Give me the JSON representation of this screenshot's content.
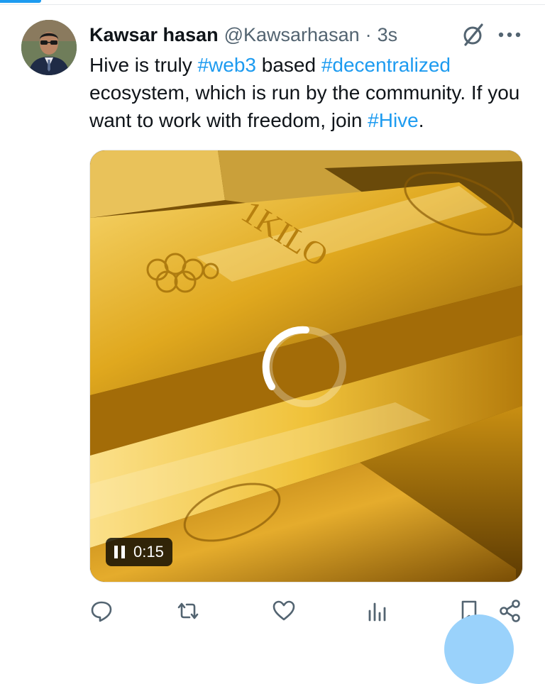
{
  "tweet": {
    "author_name": "Kawsar hasan",
    "handle": "@Kawsarhasan",
    "separator": "·",
    "time": "3s",
    "text_parts": [
      {
        "text": "Hive is truly ",
        "type": "text"
      },
      {
        "text": "#web3",
        "type": "hashtag"
      },
      {
        "text": " based ",
        "type": "text"
      },
      {
        "text": "#decentralized",
        "type": "hashtag"
      },
      {
        "text": " ecosystem, which is run by the community. If you want to work with freedom, join ",
        "type": "text"
      },
      {
        "text": "#Hive",
        "type": "hashtag"
      },
      {
        "text": ".",
        "type": "text"
      }
    ]
  },
  "media": {
    "gold_bar_engraving": "1KILO",
    "video_time": "0:15",
    "state": "paused-loading"
  },
  "icons": {
    "grok": "grok-slash-circle-icon",
    "more": "more-dots-icon",
    "reply": "reply-bubble-icon",
    "repost": "repost-arrows-icon",
    "like": "heart-icon",
    "views": "bar-chart-icon",
    "bookmark": "bookmark-icon",
    "share": "share-icon"
  },
  "colors": {
    "accent": "#1d9bf0",
    "text": "#0f1419",
    "secondary": "#536471",
    "gold": "#d9a21a"
  }
}
